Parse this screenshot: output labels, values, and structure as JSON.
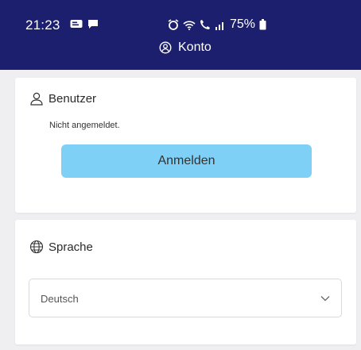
{
  "status_bar": {
    "time": "21:23",
    "left_icons": [
      "notification-icon",
      "message-icon"
    ],
    "right_icons": [
      "alarm-icon",
      "wifi-icon",
      "call-icon",
      "signal-icon",
      "battery-icon"
    ],
    "battery": "75%"
  },
  "header": {
    "title": "Konto",
    "icon": "account-circle-icon"
  },
  "user_section": {
    "icon": "user-icon",
    "heading": "Benutzer",
    "status": "Nicht angemeldet.",
    "login_button": "Anmelden"
  },
  "language_section": {
    "icon": "globe-icon",
    "heading": "Sprache",
    "selected_language": "Deutsch"
  },
  "colors": {
    "header_bg": "#1c1f6e",
    "button_bg": "#7ed0f7",
    "page_bg": "#efeff1"
  }
}
